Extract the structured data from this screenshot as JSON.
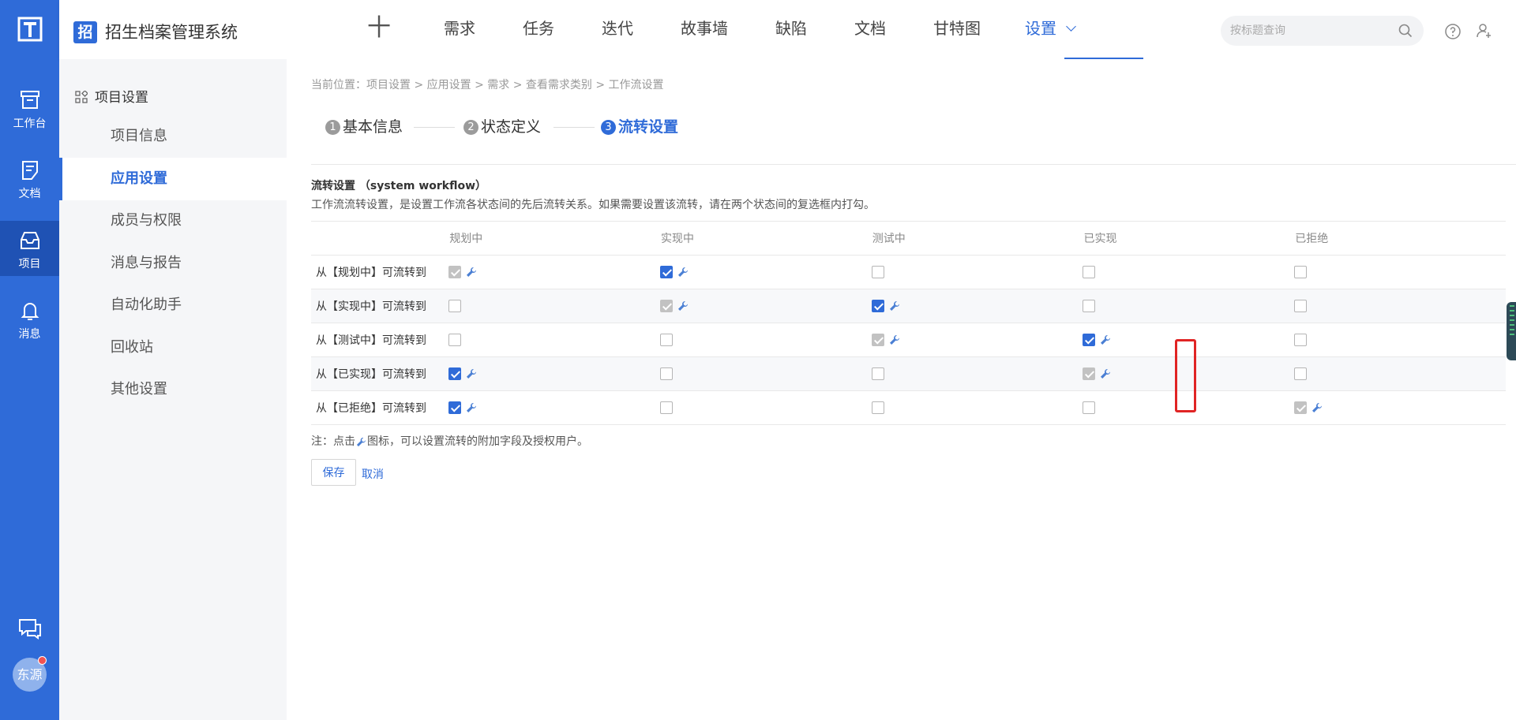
{
  "rail": {
    "items": [
      {
        "label": "工作台",
        "icon": "workbench-icon"
      },
      {
        "label": "文档",
        "icon": "document-icon"
      },
      {
        "label": "项目",
        "icon": "project-inbox-icon",
        "active": true
      },
      {
        "label": "消息",
        "icon": "bell-icon"
      }
    ],
    "avatar_text": "东源"
  },
  "header": {
    "project_badge": "招",
    "project_title": "招生档案管理系统",
    "plus": "十",
    "tabs": [
      {
        "label": "需求"
      },
      {
        "label": "任务"
      },
      {
        "label": "迭代"
      },
      {
        "label": "故事墙"
      },
      {
        "label": "缺陷"
      },
      {
        "label": "文档"
      },
      {
        "label": "甘特图"
      },
      {
        "label": "设置",
        "active": true
      }
    ],
    "search_placeholder": "按标题查询"
  },
  "sidebar": {
    "heading": "项目设置",
    "items": [
      {
        "label": "项目信息"
      },
      {
        "label": "应用设置",
        "active": true
      },
      {
        "label": "成员与权限"
      },
      {
        "label": "消息与报告"
      },
      {
        "label": "自动化助手"
      },
      {
        "label": "回收站"
      },
      {
        "label": "其他设置"
      }
    ]
  },
  "main": {
    "breadcrumb": "当前位置：项目设置 > 应用设置 > 需求 > 查看需求类别 > 工作流设置",
    "steps": [
      {
        "num": "1",
        "label": "基本信息"
      },
      {
        "num": "2",
        "label": "状态定义"
      },
      {
        "num": "3",
        "label": "流转设置",
        "active": true
      }
    ],
    "workflow_title": "流转设置 （system workflow）",
    "workflow_desc": "工作流流转设置，是设置工作流各状态间的先后流转关系。如果需要设置该流转，请在两个状态间的复选框内打勾。",
    "columns": [
      "规划中",
      "实现中",
      "测试中",
      "已实现",
      "已拒绝"
    ],
    "rows": [
      {
        "label": "从【规划中】可流转到",
        "cells": [
          "disabled",
          "checked",
          "unchecked",
          "unchecked",
          "unchecked"
        ]
      },
      {
        "label": "从【实现中】可流转到",
        "cells": [
          "unchecked",
          "disabled",
          "checked",
          "unchecked",
          "unchecked"
        ]
      },
      {
        "label": "从【测试中】可流转到",
        "cells": [
          "unchecked",
          "unchecked",
          "disabled",
          "checked",
          "unchecked"
        ]
      },
      {
        "label": "从【已实现】可流转到",
        "cells": [
          "checked",
          "unchecked",
          "unchecked",
          "disabled",
          "unchecked"
        ]
      },
      {
        "label": "从【已拒绝】可流转到",
        "cells": [
          "checked",
          "unchecked",
          "unchecked",
          "unchecked",
          "disabled"
        ]
      }
    ],
    "note_prefix": "注：点击",
    "note_suffix": "图标，可以设置流转的附加字段及授权用户。",
    "save_label": "保存",
    "cancel_label": "取消"
  },
  "colors": {
    "accent": "#2f6bd8",
    "rail": "#2f6bd8",
    "rail_active": "#1f52b4",
    "highlight": "#e02424"
  }
}
